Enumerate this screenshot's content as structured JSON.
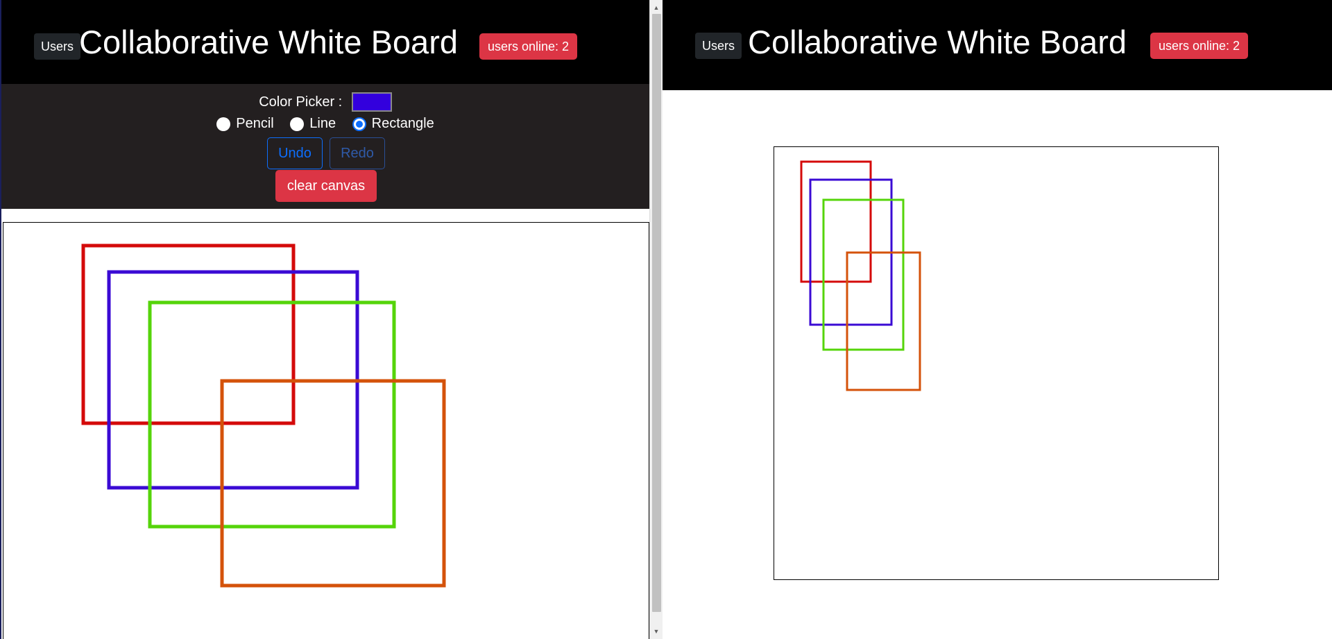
{
  "left_window": {
    "users_button": "Users",
    "title": "Collaborative White Board",
    "online_badge": "users online: 2",
    "color_picker_label": "Color Picker :",
    "color_picker_value": "#3300dd",
    "tools": [
      {
        "label": "Pencil",
        "checked": false
      },
      {
        "label": "Line",
        "checked": false
      },
      {
        "label": "Rectangle",
        "checked": true
      }
    ],
    "undo_label": "Undo",
    "redo_label": "Redo",
    "clear_label": "clear canvas"
  },
  "right_window": {
    "users_button": "Users",
    "title": "Collaborative White Board",
    "online_badge": "users online: 2"
  },
  "rectangles": [
    {
      "color": "#d40a0a"
    },
    {
      "color": "#3a0ad4"
    },
    {
      "color": "#55d40a"
    },
    {
      "color": "#d4520a"
    }
  ]
}
